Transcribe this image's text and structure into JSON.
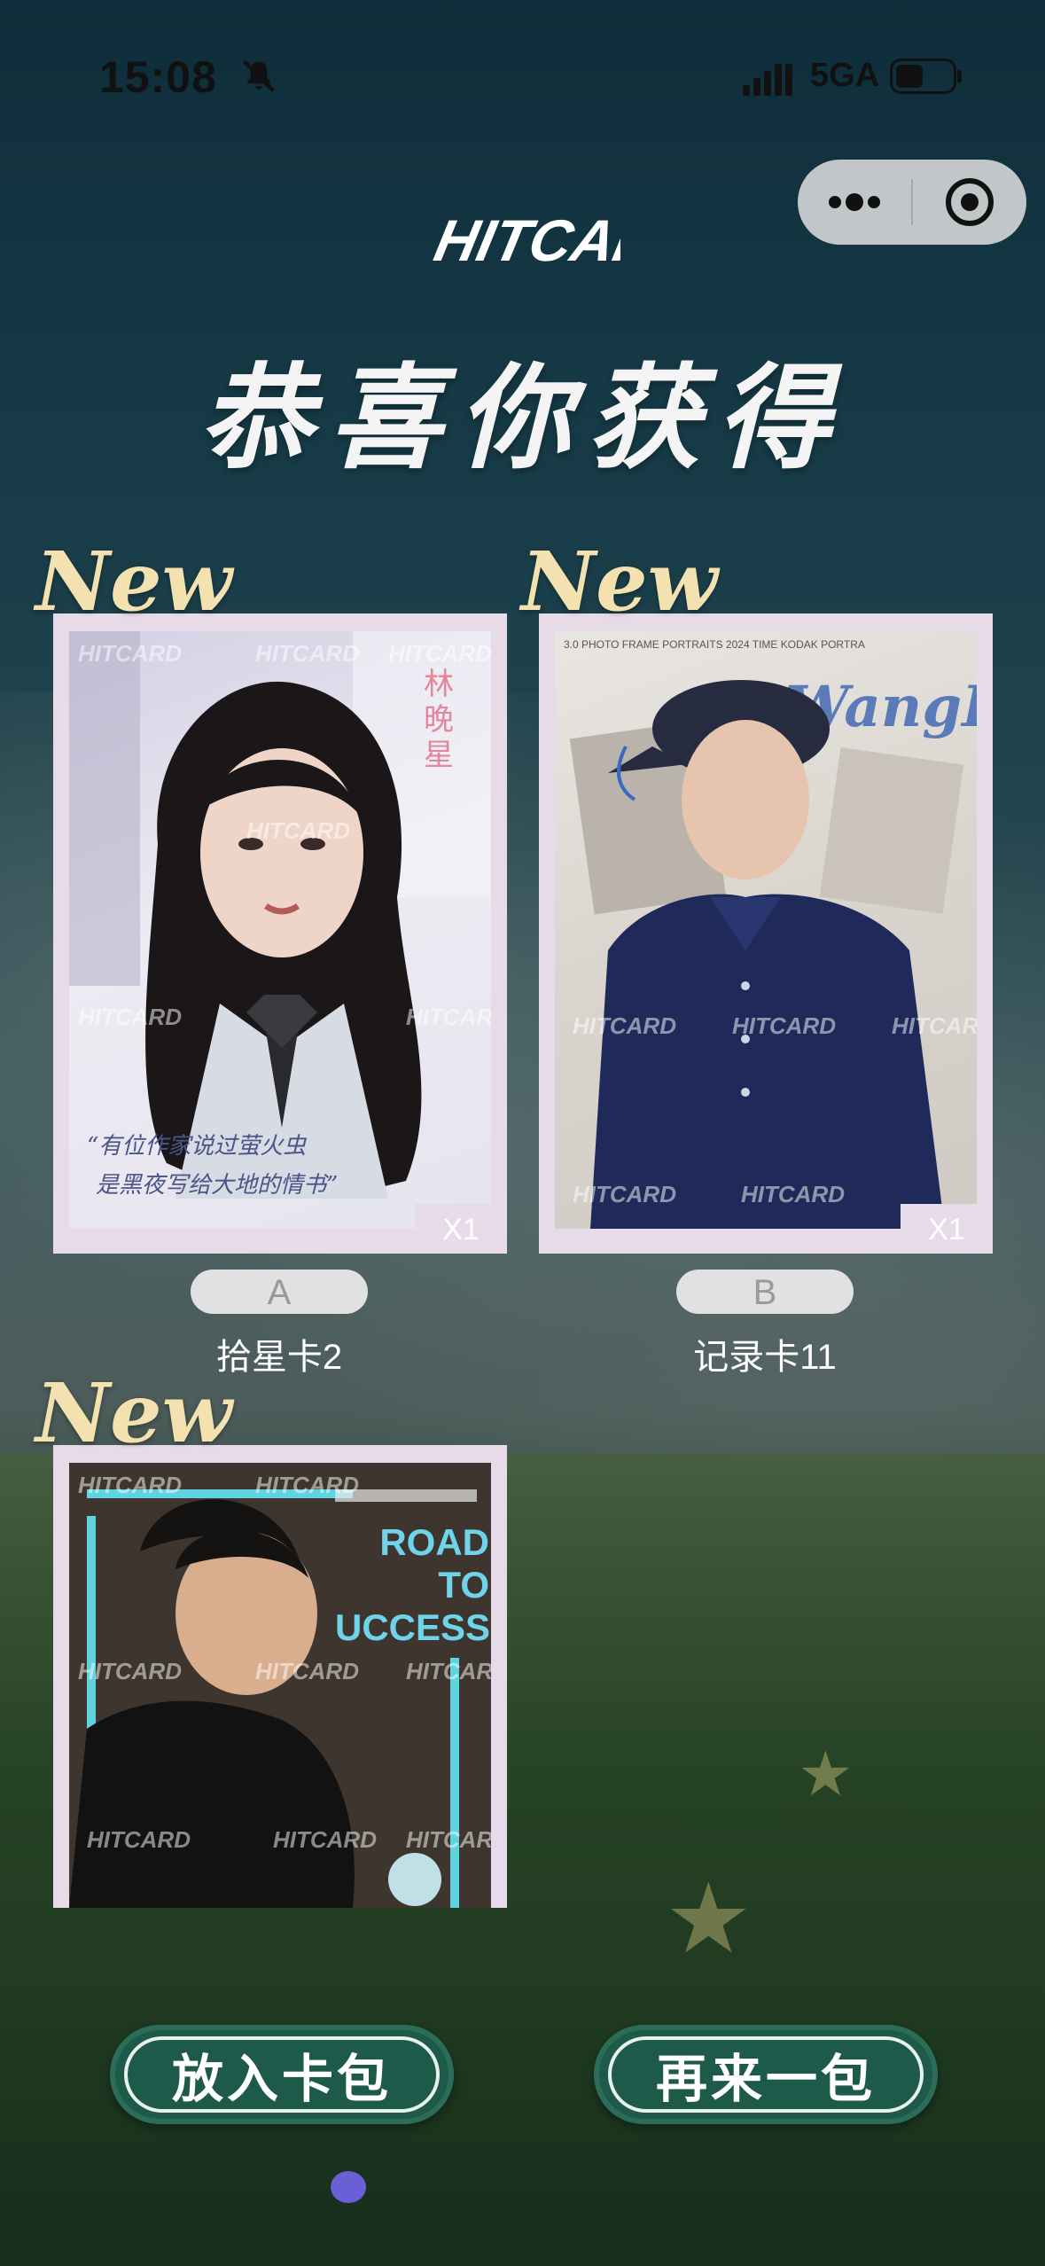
{
  "status_bar": {
    "time": "15:08",
    "network": "5GA",
    "icons": [
      "bell-mute-icon",
      "signal-icon",
      "battery-icon"
    ]
  },
  "capsule": {
    "more_icon": "more-dots-icon",
    "close_icon": "target-circle-icon"
  },
  "logo_text": "HITCARD",
  "title": "恭喜你获得",
  "cards": [
    {
      "new_tag": "New",
      "quantity": "X1",
      "rank": "A",
      "name": "拾星卡2",
      "art_text": [
        "林",
        "晚",
        "星"
      ],
      "caption_line1": "“有位作家说过萤火虫",
      "caption_line2": "是黑夜写给大地的情书”"
    },
    {
      "new_tag": "New",
      "quantity": "X1",
      "rank": "B",
      "name": "记录卡11",
      "art_text": "WangFa",
      "art_header": "3.0 PHOTO FRAME    PORTRAITS 2024 TIME    KODAK PORTRA"
    },
    {
      "new_tag": "New",
      "art_text": [
        "ROAD",
        "TO",
        "UCCESS"
      ]
    }
  ],
  "watermark": "HITCARD",
  "buttons": {
    "put_in_pack": "放入卡包",
    "another_pack": "再来一包"
  },
  "colors": {
    "card_frame": "#e8dbe9",
    "button_bg": "#1e5a4a",
    "page_dot": "#6b5fd6"
  }
}
